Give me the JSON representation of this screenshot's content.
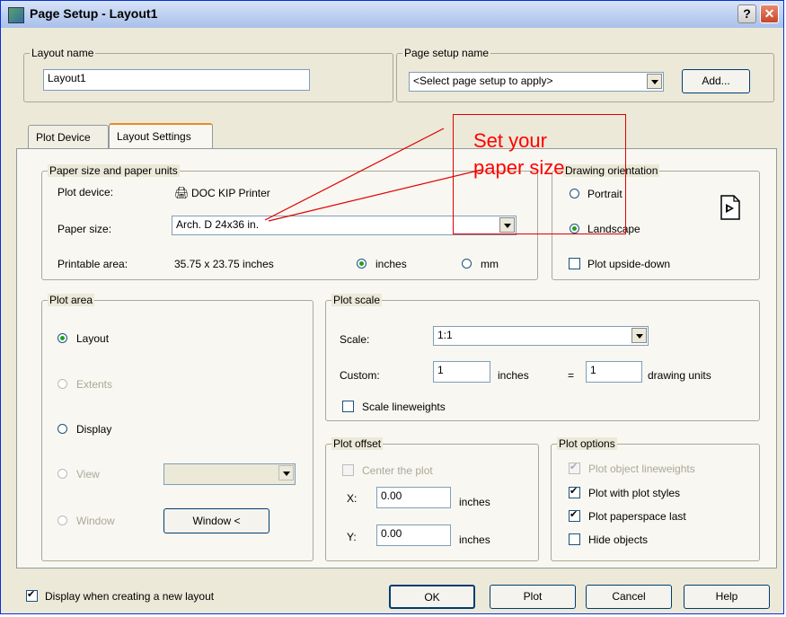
{
  "window": {
    "title": "Page Setup - Layout1",
    "help_glyph": "?",
    "close_glyph": "✕"
  },
  "layout_name": {
    "group_label": "Layout name",
    "value": "Layout1"
  },
  "page_setup": {
    "group_label": "Page setup name",
    "select_value": "<Select page setup to apply>",
    "add_label": "Add..."
  },
  "tabs": [
    {
      "label": "Plot Device"
    },
    {
      "label": "Layout Settings"
    }
  ],
  "paper": {
    "group_label": "Paper size and paper units",
    "device_label": "Plot device:",
    "device_value": "DOC KIP Printer",
    "size_label": "Paper size:",
    "size_value": "Arch. D 24x36 in.",
    "area_label": "Printable area:",
    "area_value": "35.75 x 23.75 inches",
    "units": [
      {
        "label": "inches",
        "selected": true
      },
      {
        "label": "mm",
        "selected": false
      }
    ]
  },
  "orientation": {
    "group_label": "Drawing orientation",
    "options": [
      {
        "label": "Portrait",
        "selected": false
      },
      {
        "label": "Landscape",
        "selected": true
      }
    ],
    "upside_down_label": "Plot upside-down",
    "icon": "landscape-page-icon"
  },
  "plot_area": {
    "group_label": "Plot area",
    "options": [
      {
        "label": "Layout",
        "selected": true,
        "enabled": true
      },
      {
        "label": "Extents",
        "selected": false,
        "enabled": false
      },
      {
        "label": "Display",
        "selected": false,
        "enabled": true
      },
      {
        "label": "View",
        "selected": false,
        "enabled": false
      },
      {
        "label": "Window",
        "selected": false,
        "enabled": false
      }
    ],
    "window_button": "Window <"
  },
  "plot_scale": {
    "group_label": "Plot scale",
    "scale_label": "Scale:",
    "scale_value": "1:1",
    "custom_label": "Custom:",
    "custom_inches": "1",
    "inches_label": "inches",
    "equals": "=",
    "custom_units": "1",
    "units_label": "drawing units",
    "lineweights_label": "Scale lineweights"
  },
  "plot_offset": {
    "group_label": "Plot offset",
    "center_label": "Center the plot",
    "x_label": "X:",
    "x_value": "0.00",
    "y_label": "Y:",
    "y_value": "0.00",
    "units": "inches"
  },
  "plot_options": {
    "group_label": "Plot options",
    "items": [
      {
        "label": "Plot object lineweights",
        "checked": true,
        "enabled": false
      },
      {
        "label": "Plot with plot styles",
        "checked": true,
        "enabled": true
      },
      {
        "label": "Plot paperspace last",
        "checked": true,
        "enabled": true
      },
      {
        "label": "Hide objects",
        "checked": false,
        "enabled": true
      }
    ]
  },
  "footer": {
    "display_label": "Display when creating a new layout",
    "ok": "OK",
    "plot": "Plot",
    "cancel": "Cancel",
    "help": "Help"
  },
  "annotation": {
    "text_line1": "Set your",
    "text_line2": "paper size",
    "color": "#ff0000"
  }
}
